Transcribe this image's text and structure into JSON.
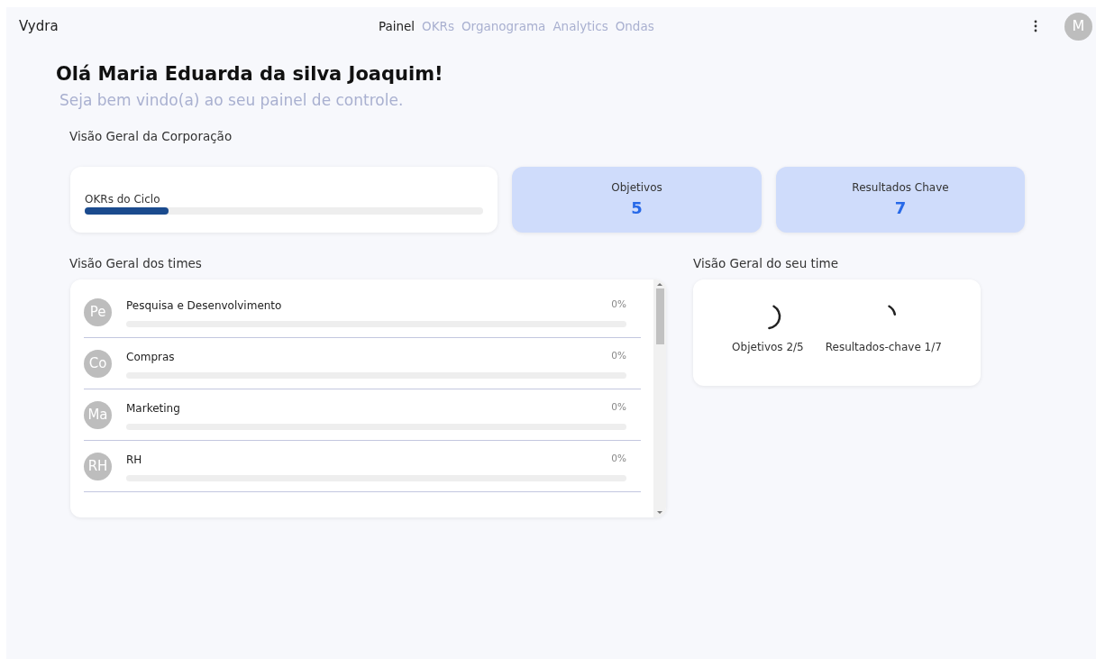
{
  "brand": "Vydra",
  "nav": [
    {
      "label": "Painel",
      "selected": true
    },
    {
      "label": "OKRs",
      "selected": false
    },
    {
      "label": "Organograma",
      "selected": false
    },
    {
      "label": "Analytics",
      "selected": false
    },
    {
      "label": "Ondas",
      "selected": false
    }
  ],
  "user_avatar": "M",
  "greeting": "Olá Maria Eduarda da silva Joaquim!",
  "subtitle": "Seja bem vindo(a) ao seu painel de controle.",
  "corporation": {
    "title": "Visão Geral da Corporação",
    "cycle": {
      "label": "OKRs do Ciclo",
      "level": 0.21
    },
    "stats": [
      {
        "label": "Objetivos",
        "value": "5"
      },
      {
        "label": "Resultados Chave",
        "value": "7"
      }
    ]
  },
  "teams": {
    "title": "Visão Geral dos times",
    "items": [
      {
        "initials": "Pe",
        "name": "Pesquisa e Desenvolvimento",
        "percent": "0%",
        "level": 0
      },
      {
        "initials": "Co",
        "name": "Compras",
        "percent": "0%",
        "level": 0
      },
      {
        "initials": "Ma",
        "name": "Marketing",
        "percent": "0%",
        "level": 0
      },
      {
        "initials": "RH",
        "name": "RH",
        "percent": "0%",
        "level": 0
      }
    ]
  },
  "my_team": {
    "title": "Visão Geral do seu time",
    "metrics": [
      {
        "label": "Objetivos 2/5"
      },
      {
        "label": "Resultados-chave 1/7"
      }
    ]
  }
}
